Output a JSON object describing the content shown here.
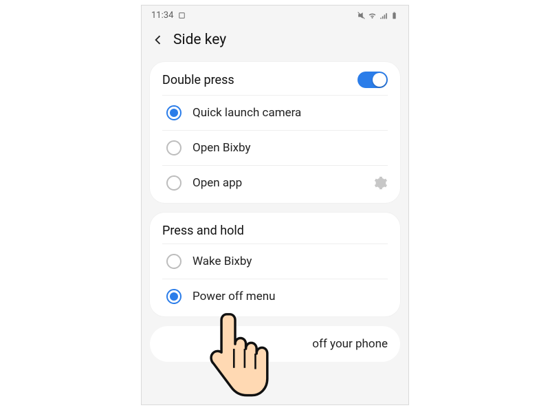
{
  "status": {
    "time": "11:34"
  },
  "header": {
    "title": "Side key"
  },
  "section1": {
    "title": "Double press",
    "opt0": "Quick launch camera",
    "opt1": "Open Bixby",
    "opt2": "Open app"
  },
  "section2": {
    "title": "Press and hold",
    "opt0": "Wake Bixby",
    "opt1": "Power off menu"
  },
  "tip": {
    "text_tail": "off your phone"
  }
}
